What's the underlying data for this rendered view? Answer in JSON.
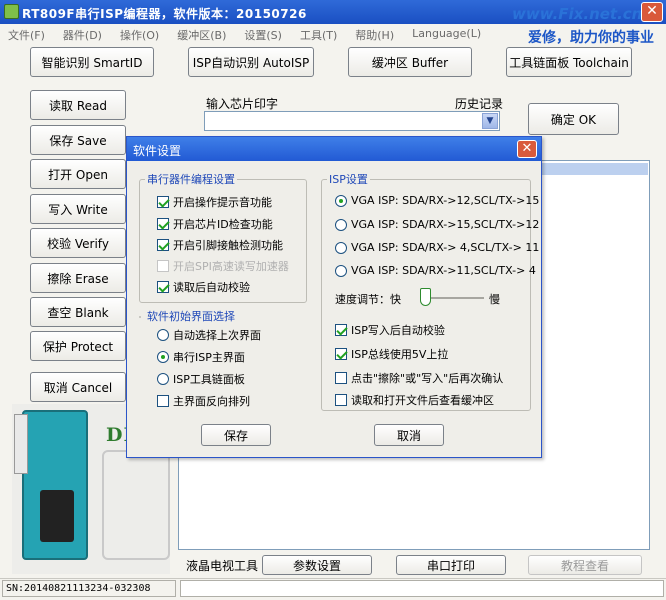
{
  "window": {
    "title": "RT809F串行ISP编程器，软件版本：20150726",
    "watermark": "www.Fix.net.cn",
    "slogan": "爱修，助力你的事业"
  },
  "menu": [
    "文件(F)",
    "器件(D)",
    "操作(O)",
    "缓冲区(B)",
    "设置(S)",
    "工具(T)",
    "帮助(H)",
    "Language(L)"
  ],
  "top_buttons": {
    "smart_id": "智能识别 SmartID",
    "isp_id": "ISP自动识别 AutoISP",
    "buffer": "缓冲区 Buffer",
    "toolchain": "工具链面板 Toolchain"
  },
  "side_buttons": {
    "read": "读取 Read",
    "save": "保存 Save",
    "open": "打开 Open",
    "write": "写入 Write",
    "verify": "校验 Verify",
    "erase": "擦除 Erase",
    "blank": "查空 Blank",
    "protect": "保护 Protect",
    "cancel": "取消 Cancel"
  },
  "chip_input": {
    "label": "输入芯片印字",
    "history_label": "历史记录",
    "value": "",
    "ok_button": "确定 OK"
  },
  "chip_image": {
    "text": "DI"
  },
  "bottom_bar": {
    "lcd_label": "液晶电视工具",
    "params_button": "参数设置",
    "serial_print_button": "串口打印",
    "tutorial_button": "教程查看"
  },
  "status": {
    "sn": "SN:20140821113234-032308"
  },
  "dialog": {
    "title": "软件设置",
    "serial_group": {
      "title": "串行器件编程设置",
      "options": [
        {
          "label": "开启操作提示音功能",
          "checked": true,
          "enabled": true
        },
        {
          "label": "开启芯片ID检查功能",
          "checked": true,
          "enabled": true
        },
        {
          "label": "开启引脚接触检测功能",
          "checked": true,
          "enabled": true
        },
        {
          "label": "开启SPI高速读写加速器",
          "checked": false,
          "enabled": false
        },
        {
          "label": "读取后自动校验",
          "checked": true,
          "enabled": true
        }
      ]
    },
    "init_group": {
      "title": "软件初始界面选择",
      "options": [
        {
          "label": "自动选择上次界面",
          "selected": false
        },
        {
          "label": "串行ISP主界面",
          "selected": true
        },
        {
          "label": "ISP工具链面板",
          "selected": false
        }
      ],
      "reverse_label": "主界面反向排列",
      "reverse_checked": false
    },
    "isp_group": {
      "title": "ISP设置",
      "vga_options": [
        {
          "label": "VGA ISP: SDA/RX->12,SCL/TX->15",
          "selected": true
        },
        {
          "label": "VGA ISP: SDA/RX->15,SCL/TX->12",
          "selected": false
        },
        {
          "label": "VGA ISP: SDA/RX-> 4,SCL/TX-> 11",
          "selected": false
        },
        {
          "label": "VGA ISP: SDA/RX->11,SCL/TX-> 4",
          "selected": false
        }
      ],
      "speed_label": "速度调节：快",
      "speed_slow": "慢",
      "speed_level": 0.0,
      "checks": [
        {
          "label": "ISP写入后自动校验",
          "checked": true
        },
        {
          "label": "ISP总线使用5V上拉",
          "checked": true
        },
        {
          "label": "点击\"擦除\"或\"写入\"后再次确认",
          "checked": false
        },
        {
          "label": "读取和打开文件后查看缓冲区",
          "checked": false
        }
      ]
    },
    "save_button": "保存",
    "cancel_button": "取消"
  }
}
